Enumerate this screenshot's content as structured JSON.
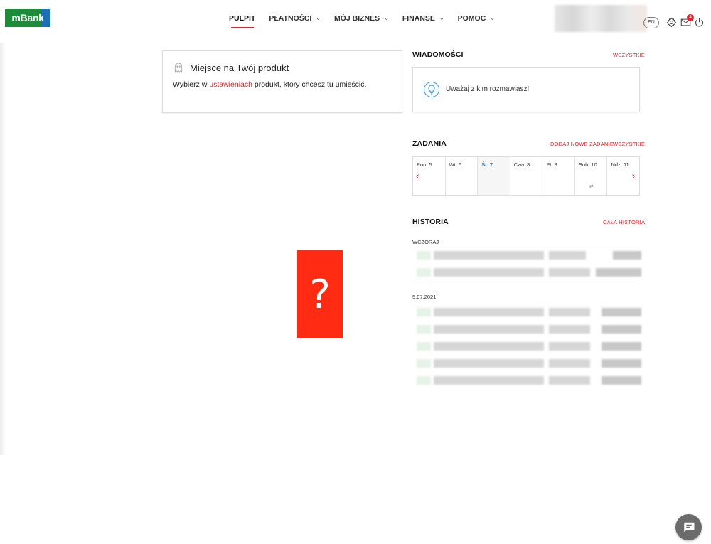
{
  "header": {
    "logo_text": "mBank",
    "nav": [
      {
        "label": "PULPIT",
        "active": true
      },
      {
        "label": "PŁATNOŚCI",
        "dropdown": true
      },
      {
        "label": "MÓJ BIZNES",
        "dropdown": true
      },
      {
        "label": "FINANSE",
        "dropdown": true
      },
      {
        "label": "POMOC",
        "dropdown": true
      }
    ],
    "lang": "EN",
    "badge_count": "4",
    "icons": [
      "gear-icon",
      "envelope-icon",
      "power-icon"
    ]
  },
  "product": {
    "title": "Miejsce na Twój produkt",
    "desc_before": "Wybierz w ",
    "desc_link": "ustawieniach",
    "desc_after": " produkt, który chcesz tu umieścić.",
    "icon": "ghost-icon"
  },
  "placeholder": {
    "glyph": "?"
  },
  "messages": {
    "title": "WIADOMOŚCI",
    "link": "WSZYSTKIE",
    "text": "Uważaj z kim rozmawiasz!",
    "icon": "lightbulb-icon"
  },
  "tasks": {
    "title": "ZADANIA",
    "add_link": "DODAJ NOWE ZADANIE",
    "all_link": "WSZYSTKIE",
    "days": [
      "Pon. 5",
      "Wt. 6",
      "Śr. 7",
      "Czw. 8",
      "Pt. 9",
      "Sob. 10",
      "Ndz. 11"
    ],
    "today_index": 2
  },
  "history": {
    "title": "HISTORIA",
    "link": "CAŁA HISTORIA",
    "groups": [
      {
        "date": "WCZORAJ"
      },
      {
        "date": "5.07.2021"
      }
    ]
  },
  "colors": {
    "accent": "#d8282f",
    "today": "#1d7bc4",
    "logo_green": "#1c8c3a",
    "logo_blue": "#1d6fb8",
    "placeholder": "#ff2b12"
  }
}
